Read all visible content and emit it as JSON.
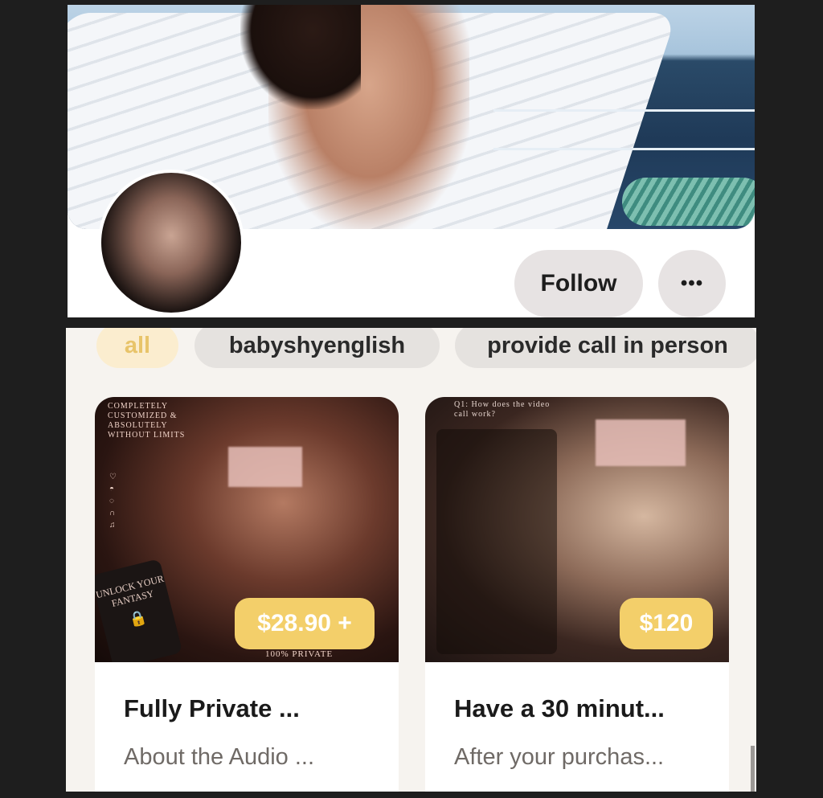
{
  "profile": {
    "follow_label": "Follow",
    "more_label": "•••"
  },
  "tabs": [
    {
      "label": "all",
      "active": true
    },
    {
      "label": "babyshyenglish",
      "active": false
    },
    {
      "label": "provide call in person",
      "active": false
    }
  ],
  "cards": [
    {
      "price": "$28.90 +",
      "title": "Fully Private ...",
      "subtitle": "About the Audio ...",
      "overlay_text": "COMPLETELY CUSTOMIZED & ABSOLUTELY WITHOUT LIMITS",
      "unlock_text": "UNLOCK YOUR FANTASY",
      "footer_text": "100% PRIVATE"
    },
    {
      "price": "$120",
      "title": "Have a 30 minut...",
      "subtitle": "After your purchas...",
      "overlay_text": "Q1: How does the video call work?"
    }
  ],
  "colors": {
    "accent": "#f3cf6a",
    "tab_active_bg": "#fbedcf",
    "tab_bg": "#e5e2df",
    "button_bg": "#e7e3e3"
  }
}
